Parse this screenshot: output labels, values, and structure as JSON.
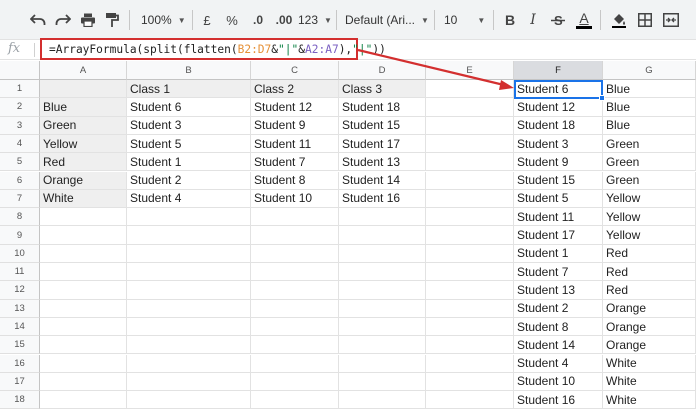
{
  "toolbar": {
    "zoom": "100%",
    "currency": "£",
    "percent": "%",
    "decrease_decimals": ".0",
    "increase_decimals": ".00",
    "more_formats": "123",
    "font_family": "Default (Ari...",
    "font_size": "10",
    "bold": "B",
    "italic": "I",
    "text_color": "A",
    "icons": [
      "undo-icon",
      "redo-icon",
      "print-icon",
      "paint-format-icon",
      "strikethrough-icon",
      "fill-color-icon",
      "borders-icon",
      "merge-cells-icon"
    ]
  },
  "formula_bar": {
    "fx_label": "fx",
    "parts": {
      "p1": "=ArrayFormula(split(flatten(",
      "ref1": "B2:D7",
      "p2": "&",
      "str1": "\"|\"",
      "p3": "&",
      "ref2": "A2:A7",
      "p4": "),",
      "str2": "\"|\"",
      "p5": "))"
    }
  },
  "grid": {
    "columns": [
      "A",
      "B",
      "C",
      "D",
      "E",
      "F",
      "G"
    ],
    "selected_column": "F",
    "rows": [
      "1",
      "2",
      "3",
      "4",
      "5",
      "6",
      "7",
      "8",
      "9",
      "10",
      "11",
      "12",
      "13",
      "14",
      "15",
      "16",
      "17",
      "18"
    ],
    "source_table": [
      [
        "",
        "Class 1",
        "Class 2",
        "Class 3"
      ],
      [
        "Blue",
        "Student 6",
        "Student 12",
        "Student 18"
      ],
      [
        "Green",
        "Student 3",
        "Student 9",
        "Student 15"
      ],
      [
        "Yellow",
        "Student 5",
        "Student 11",
        "Student 17"
      ],
      [
        "Red",
        "Student 1",
        "Student 7",
        "Student 13"
      ],
      [
        "Orange",
        "Student 2",
        "Student 8",
        "Student 14"
      ],
      [
        "White",
        "Student 4",
        "Student 10",
        "Student 16"
      ]
    ],
    "result_table": [
      [
        "Student 6",
        "Blue"
      ],
      [
        "Student 12",
        "Blue"
      ],
      [
        "Student 18",
        "Blue"
      ],
      [
        "Student 3",
        "Green"
      ],
      [
        "Student 9",
        "Green"
      ],
      [
        "Student 15",
        "Green"
      ],
      [
        "Student 5",
        "Yellow"
      ],
      [
        "Student 11",
        "Yellow"
      ],
      [
        "Student 17",
        "Yellow"
      ],
      [
        "Student 1",
        "Red"
      ],
      [
        "Student 7",
        "Red"
      ],
      [
        "Student 13",
        "Red"
      ],
      [
        "Student 2",
        "Orange"
      ],
      [
        "Student 8",
        "Orange"
      ],
      [
        "Student 14",
        "Orange"
      ],
      [
        "Student 4",
        "White"
      ],
      [
        "Student 10",
        "White"
      ],
      [
        "Student 16",
        "White"
      ]
    ]
  },
  "colors": {
    "annotation": "#d32f2f",
    "selection": "#1a73e8",
    "ref_b2_d7": "#e69138",
    "ref_a2_a7": "#7b61c2",
    "string_literal": "#0b8043"
  }
}
